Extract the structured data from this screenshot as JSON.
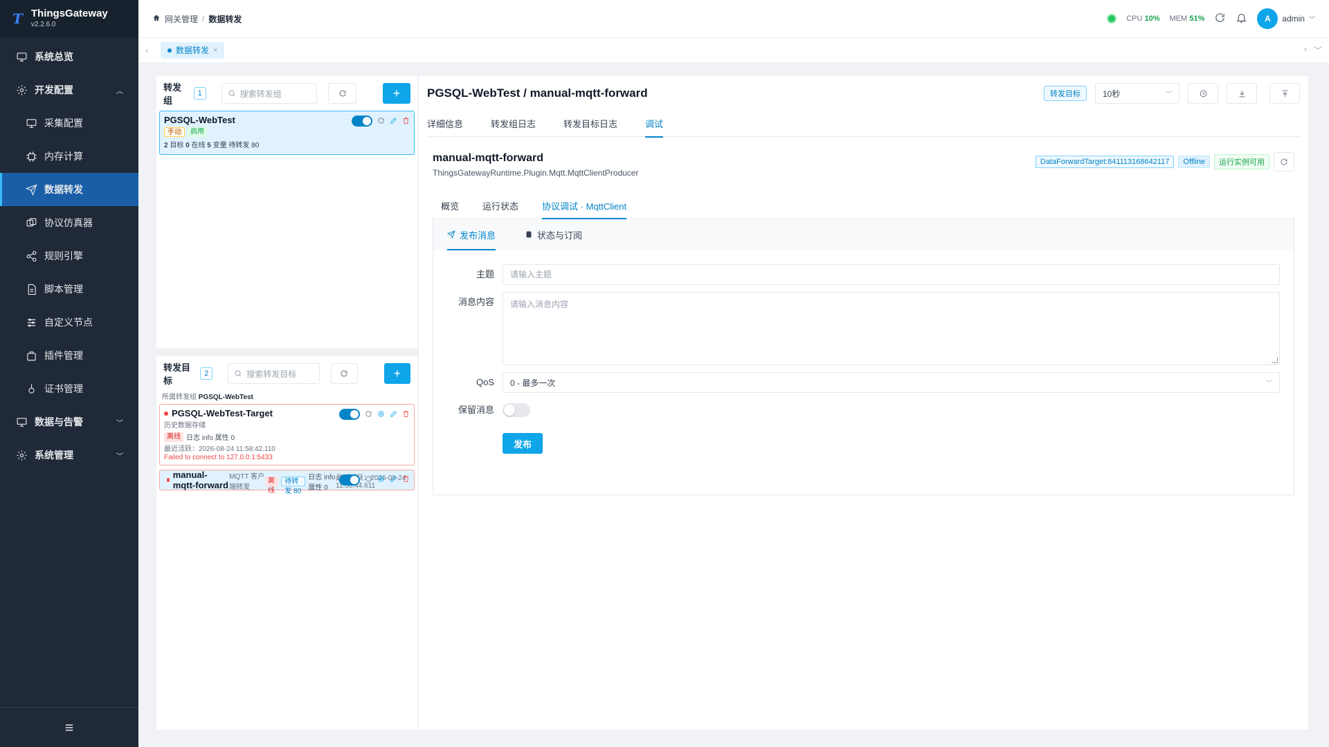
{
  "app": {
    "name": "ThingsGateway",
    "version": "v2.2.6.0"
  },
  "sidebar": {
    "items": [
      {
        "label": "系统总览",
        "icon": "monitor-icon"
      },
      {
        "label": "开发配置",
        "icon": "gear-icon"
      },
      {
        "label": "采集配置",
        "icon": "monitor-icon"
      },
      {
        "label": "内存计算",
        "icon": "chip-icon"
      },
      {
        "label": "数据转发",
        "icon": "send-icon"
      },
      {
        "label": "协议仿真器",
        "icon": "simulator-icon"
      },
      {
        "label": "规则引擎",
        "icon": "share-icon"
      },
      {
        "label": "脚本管理",
        "icon": "document-icon"
      },
      {
        "label": "自定义节点",
        "icon": "sliders-icon"
      },
      {
        "label": "插件管理",
        "icon": "plugin-icon"
      },
      {
        "label": "证书管理",
        "icon": "certificate-icon"
      },
      {
        "label": "数据与告警",
        "icon": "monitor-icon"
      },
      {
        "label": "系统管理",
        "icon": "gear-icon"
      }
    ],
    "active": "数据转发"
  },
  "header": {
    "breadcrumb": [
      "网关管理",
      "数据转发"
    ],
    "cpu_label": "CPU",
    "cpu_value": "10%",
    "mem_label": "MEM",
    "mem_value": "51%",
    "user_initial": "A",
    "user_name": "admin"
  },
  "tabbar": {
    "tab_label": "数据转发"
  },
  "groups": {
    "title": "转发组",
    "count": "1",
    "search_placeholder": "搜索转发组",
    "add_label": "+",
    "card": {
      "name": "PGSQL-WebTest",
      "tag_mode": "手动",
      "tag_status": "启用",
      "stats": {
        "targets": "2",
        "targets_label": "目标",
        "online": "0",
        "online_label": "在线",
        "vars": "5",
        "vars_label": "变量",
        "pending_label": "待转发",
        "pending": "80"
      }
    }
  },
  "targets": {
    "title": "转发目标",
    "count": "2",
    "search_placeholder": "搜索转发目标",
    "add_label": "+",
    "owner_label": "所属转发组",
    "owner_value": "PGSQL-WebTest",
    "items": [
      {
        "name": "PGSQL-WebTest-Target",
        "desc": "历史数据存储",
        "status": "离线",
        "log_info": "日志 info 属性 0",
        "last_active": "最近活跃：2026-08-24 11:58:42.110",
        "error": "Failed to connect to 127.0.0.1:5433"
      },
      {
        "name": "manual-mqtt-forward",
        "desc": "MQTT 客户端转发",
        "status": "离线",
        "pending": "待转发 80",
        "log_info": "日志 info 属性 0",
        "last_active": "最近活跃：2026-08-24 11:58:44.611"
      }
    ]
  },
  "main": {
    "title": "PGSQL-WebTest / manual-mqtt-forward",
    "target_tag": "转发目标",
    "refresh_interval": "10秒",
    "tabs": [
      "详细信息",
      "转发组日志",
      "转发目标日志",
      "调试"
    ],
    "active_tab": "调试",
    "instance": {
      "name": "manual-mqtt-forward",
      "class": "ThingsGatewayRuntime.Plugin.Mqtt.MqttClientProducer",
      "tag_id": "DataForwardTarget:841113168642117",
      "tag_status": "Offline",
      "tag_runtime": "运行实例可用"
    },
    "sub_tabs": [
      "概览",
      "运行状态",
      "协议调试 · MqttClient"
    ],
    "active_sub_tab": "协议调试 · MqttClient",
    "debug_tabs": [
      "发布消息",
      "状态与订阅"
    ],
    "form": {
      "topic_label": "主题",
      "topic_placeholder": "请输入主题",
      "payload_label": "消息内容",
      "payload_placeholder": "请输入消息内容",
      "qos_label": "QoS",
      "qos_value": "0 - 最多一次",
      "retain_label": "保留消息",
      "publish_label": "发布"
    }
  },
  "colors": {
    "accent": "#0ea5e9",
    "sidebar_bg": "#1f2937",
    "sidebar_active": "#1a5ea8",
    "danger": "#ef4444",
    "success": "#16a34a"
  }
}
